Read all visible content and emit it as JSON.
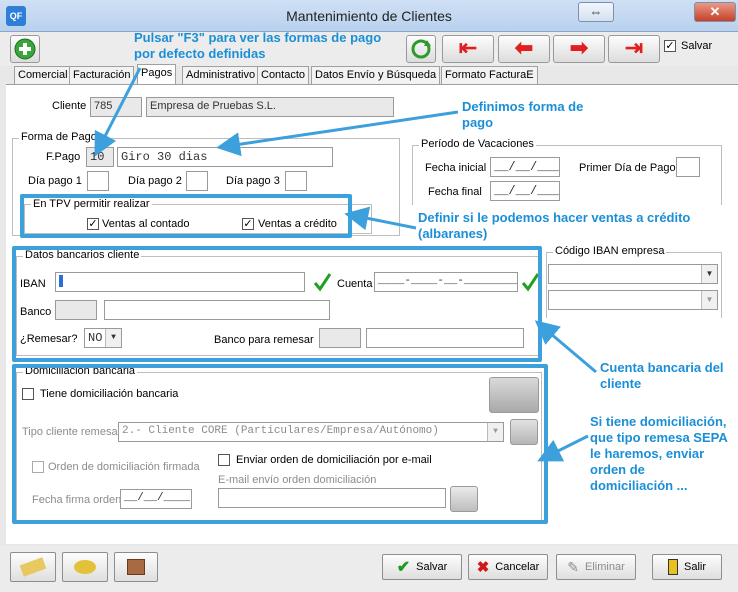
{
  "window": {
    "title": "Mantenimiento de Clientes",
    "app_icon": "QF"
  },
  "toolbar": {
    "save_check_label": "Salvar"
  },
  "tabs": [
    "Comercial",
    "Facturación",
    "Pagos",
    "Administrativo",
    "Contacto",
    "Datos Envío y Búsqueda",
    "Formato FacturaE"
  ],
  "cliente": {
    "label": "Cliente",
    "code": "785",
    "name": "Empresa de Pruebas S.L."
  },
  "forma_pago": {
    "group_title": "Forma de Pago",
    "fpago_label": "F.Pago",
    "fpago_code": "10",
    "fpago_desc": "Giro 30 dias",
    "dia1_label": "Día pago 1",
    "dia2_label": "Día pago 2",
    "dia3_label": "Día pago 3"
  },
  "vacaciones": {
    "group_title": "Período de Vacaciones",
    "inicial_label": "Fecha inicial",
    "inicial_value": "__/__/___",
    "final_label": "Fecha final",
    "final_value": "__/__/___",
    "primer_dia_label": "Primer Día de Pago"
  },
  "tpv": {
    "group_title": "En TPV permitir realizar",
    "contado_label": "Ventas al contado",
    "credito_label": "Ventas a crédito"
  },
  "banco": {
    "group_title": "Datos bancarios cliente",
    "iban_label": "IBAN",
    "cuenta_label": "Cuenta",
    "cuenta_value": "____-____-__-__________",
    "banco_label": "Banco",
    "remesar_label": "¿Remesar?",
    "remesar_value": "NO",
    "banco_remesar_label": "Banco para remesar"
  },
  "iban_empresa": {
    "group_title": "Código IBAN empresa"
  },
  "domiciliacion": {
    "group_title": "Domiciliación bancaria",
    "tiene_label": "Tiene domiciliación bancaria",
    "tipo_label": "Tipo cliente remesa",
    "tipo_value": "2.-  Cliente CORE (Particulares/Empresa/Autónomo)",
    "orden_firmada_label": "Orden de domiciliación firmada",
    "enviar_label": "Enviar orden de domiciliación por e-mail",
    "email_label": "E-mail envío orden domiciliación",
    "fecha_label": "Fecha firma orden",
    "fecha_value": "__/__/____"
  },
  "annotations": {
    "f3": "Pulsar \"F3\" para ver las formas de pago por defecto definidas",
    "definimos": "Definimos forma de pago",
    "tpv": "Definir si le podemos hacer ventas a crédito (albaranes)",
    "cuenta": "Cuenta bancaria del cliente",
    "domic": "Si tiene domiciliación, que tipo remesa SEPA le haremos, enviar orden de domiciliación ..."
  },
  "bottom": {
    "salvar": "Salvar",
    "cancelar": "Cancelar",
    "eliminar": "Eliminar",
    "salir": "Salir"
  },
  "colors": {
    "annotation": "#1a8fd8",
    "highlight": "#3ca0dc",
    "titlebar": "#c4d8f0"
  }
}
